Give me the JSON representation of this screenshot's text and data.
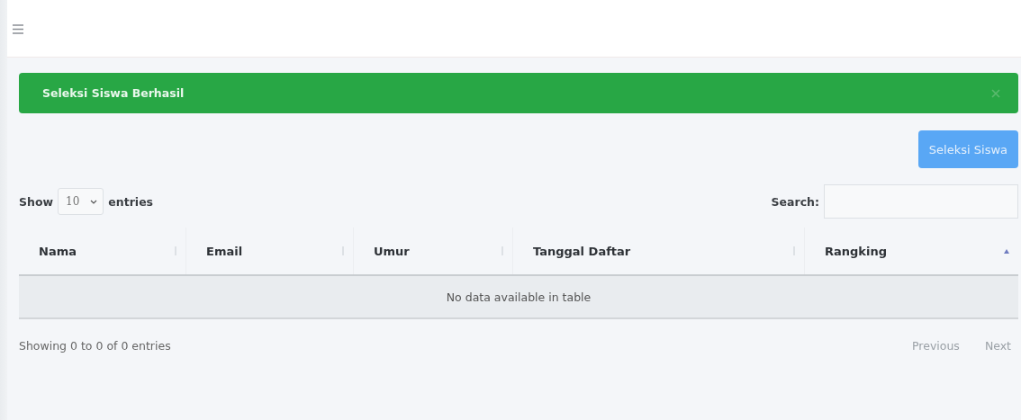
{
  "alert": {
    "message": "Seleksi Siswa Berhasil",
    "dismissible": true
  },
  "action_button": {
    "label": "Seleksi Siswa"
  },
  "length": {
    "prefix": "Show",
    "value": "10",
    "suffix": "entries"
  },
  "search": {
    "label": "Search:"
  },
  "table": {
    "columns": [
      {
        "label": "Nama",
        "sorted": false
      },
      {
        "label": "Email",
        "sorted": false
      },
      {
        "label": "Umur",
        "sorted": false
      },
      {
        "label": "Tanggal Daftar",
        "sorted": false
      },
      {
        "label": "Rangking",
        "sorted": true
      }
    ],
    "empty_message": "No data available in table"
  },
  "info": "Showing 0 to 0 of 0 entries",
  "pagination": [
    {
      "label": "Previous",
      "disabled": true
    },
    {
      "label": "Next",
      "disabled": true
    }
  ]
}
